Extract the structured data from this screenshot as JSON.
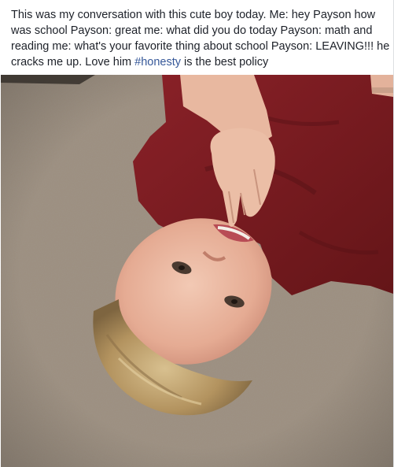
{
  "post": {
    "lines": [
      "This was my conversation with this cute boy today. Me: hey Payson how",
      "was school Payson: great me: what did you do today Payson: math and",
      "reading me: what's your favorite thing about school Payson: LEAVING!!! he"
    ],
    "last_line_before": "cracks me up. Love him ",
    "hashtag": "#honesty",
    "last_line_after": " is the best policy"
  },
  "photo": {
    "subject": "child-lying-on-carpet",
    "colors": {
      "carpet": "#9c8e7e",
      "shirt": "#7a1b20",
      "skin": "#e8b8a0",
      "hair": "#b89a6c"
    }
  }
}
